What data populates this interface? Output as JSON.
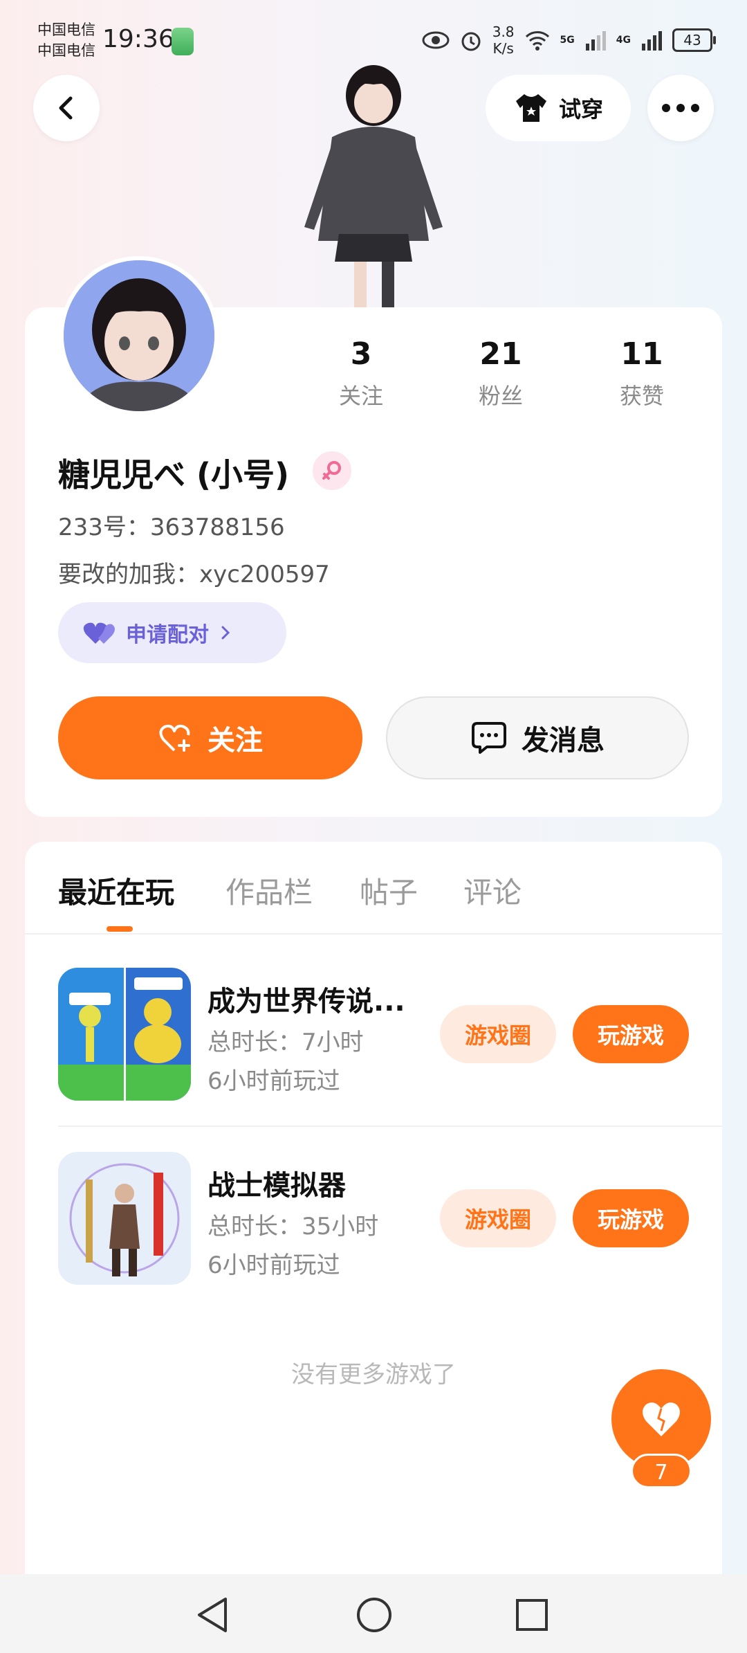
{
  "status_bar": {
    "carrier_1": "中国电信",
    "carrier_2": "中国电信",
    "time": "19:36",
    "speed_value": "3.8",
    "speed_unit": "K/s",
    "network_1": "5G",
    "network_2": "4G",
    "battery": "43"
  },
  "header": {
    "try_on_label": "试穿"
  },
  "profile": {
    "stats": [
      {
        "value": "3",
        "label": "关注"
      },
      {
        "value": "21",
        "label": "粉丝"
      },
      {
        "value": "11",
        "label": "获赞"
      }
    ],
    "name": "糖児児べ (小号)",
    "id_line": "233号：363788156",
    "bio": "要改的加我：xyc200597",
    "pair_label": "申请配对",
    "follow_label": "关注",
    "message_label": "发消息"
  },
  "tabs": [
    "最近在玩",
    "作品栏",
    "帖子",
    "评论"
  ],
  "games": [
    {
      "title": "成为世界传说...",
      "duration": "总时长：7小时",
      "last_played": "6小时前玩过",
      "circle_label": "游戏圈",
      "play_label": "玩游戏"
    },
    {
      "title": "战士模拟器",
      "duration": "总时长：35小时",
      "last_played": "6小时前玩过",
      "circle_label": "游戏圈",
      "play_label": "玩游戏"
    }
  ],
  "no_more_text": "没有更多游戏了",
  "like_count": "7",
  "colors": {
    "accent": "#ff7418",
    "pair": "#6a60d8"
  }
}
